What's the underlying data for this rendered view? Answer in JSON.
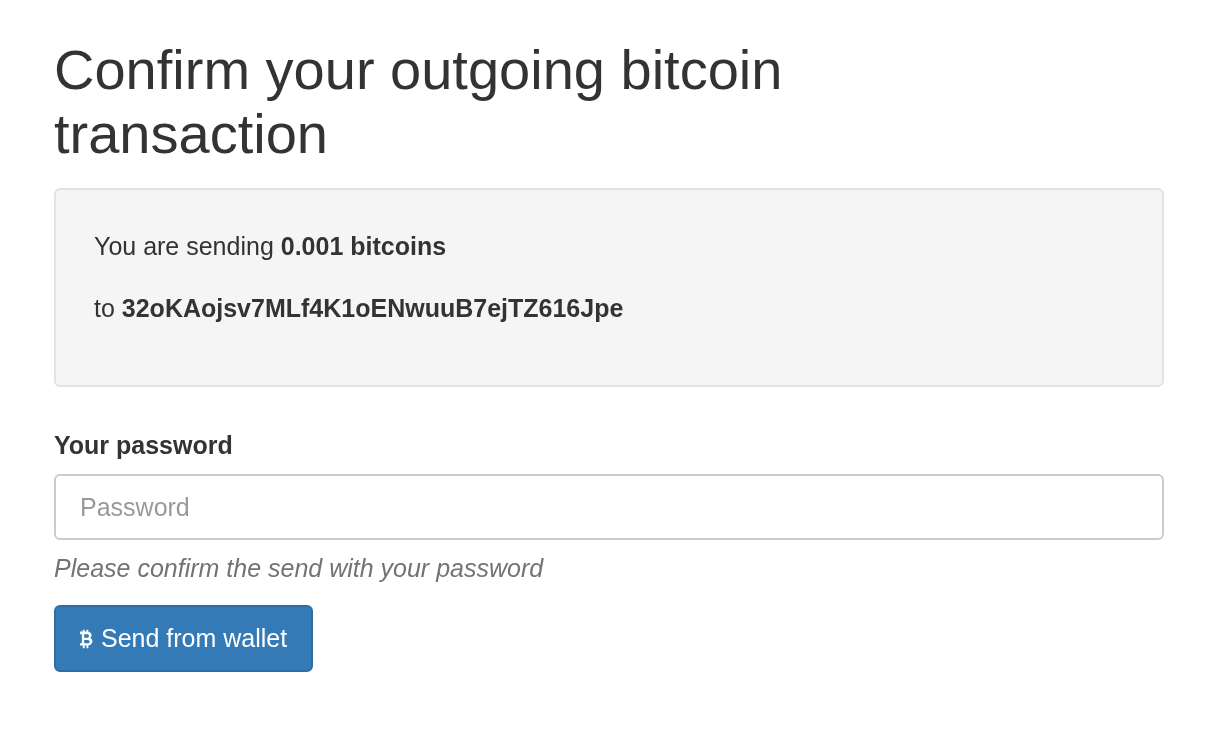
{
  "heading": "Confirm your outgoing bitcoin transaction",
  "summary": {
    "amount_line": "You are sending **0.001 bitcoins**",
    "address_line": "to **32oKAojsv7MLf4K1oENwuuB7ejTZ616Jpe**"
  },
  "password": {
    "label": "Your password",
    "placeholder": "Password",
    "help": "Please confirm the send with your password"
  },
  "button": {
    "label": "Send from wallet"
  }
}
